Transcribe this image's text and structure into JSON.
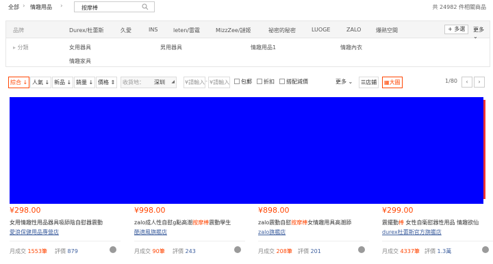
{
  "breadcrumb": {
    "all": "全部",
    "category": "情趣用品",
    "query": "按摩棒"
  },
  "total": {
    "prefix": "共",
    "count": "24982",
    "suffix": "件相關商品"
  },
  "filters": {
    "brand_label": "品牌",
    "brands": [
      "Durex/杜蕾斯",
      "久愛",
      "INS",
      "leten/雷霆",
      "MizzZee/謎姬",
      "祕密的秘密",
      "LUOGE",
      "ZALO",
      "爆熱空間"
    ],
    "multi_select": "+ 多選",
    "more": "更多",
    "category_label": "分類",
    "categories": [
      "女用器具",
      "男用器具",
      "情趣用品1",
      "情趣內衣",
      "情趣家具"
    ]
  },
  "sort": {
    "items": [
      {
        "label": "綜合"
      },
      {
        "label": "人氣"
      },
      {
        "label": "新品"
      },
      {
        "label": "銷量"
      },
      {
        "label": "價格"
      }
    ],
    "ship_label": "收貨地：",
    "ship_value": "深圳",
    "price_min": "¥請輸入",
    "price_max": "¥請輸入",
    "options": [
      "包郵",
      "折扣",
      "搭配減價"
    ],
    "more": "更多",
    "view_shop": "店鋪",
    "view_grid": "大圖",
    "page": "1/80"
  },
  "colors": {
    "accent": "#ff4400",
    "banner": "#0000ff",
    "link": "#3c5e9e",
    "highlight": "#ff4400"
  },
  "products": [
    {
      "price": "¥298.00",
      "title_pre": "女用情趣性用品器具吸舔陰自慰器震動",
      "title_hl": "",
      "title_post": "",
      "shop": "愛浪保健用品專營店",
      "sold_label": "月成交",
      "sold": "1553筆",
      "review_label": "評價",
      "reviews": "879"
    },
    {
      "price": "¥998.00",
      "title_pre": "zalo成人性自慰g點高潮",
      "title_hl": "按摩棒",
      "title_post": "震動學生",
      "shop": "酷適風旗艦店",
      "sold_label": "月成交",
      "sold": "90筆",
      "review_label": "評價",
      "reviews": "243"
    },
    {
      "price": "¥898.00",
      "title_pre": "zalo震動自慰",
      "title_hl": "按摩棒",
      "title_post": "女情趣用具高潮舔",
      "shop": "zalo旗艦店",
      "sold_label": "月成交",
      "sold": "208筆",
      "review_label": "評價",
      "reviews": "201"
    },
    {
      "price": "¥299.00",
      "title_pre": "震擺動",
      "title_hl": "棒",
      "title_post": " 女性自衛慰器性用品 情趣欲仙",
      "shop": "durex杜蕾斯官方旗艦店",
      "sold_label": "月成交",
      "sold": "4337筆",
      "review_label": "評價",
      "reviews": "1.3萬"
    }
  ]
}
